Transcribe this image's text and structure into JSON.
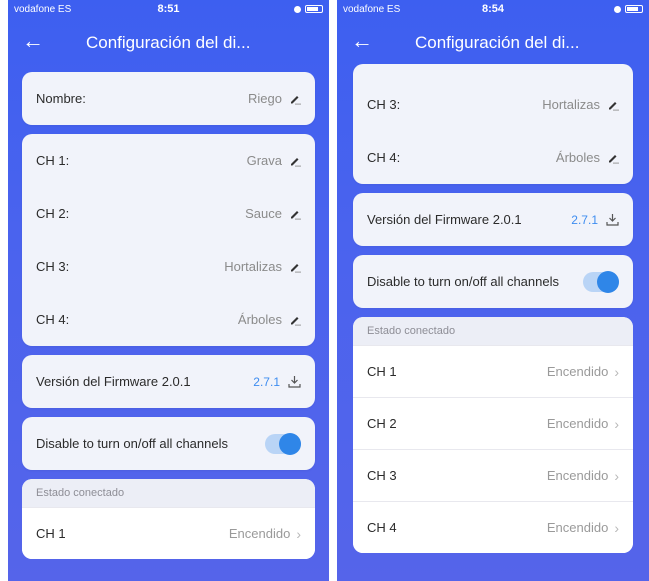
{
  "left": {
    "status": {
      "carrier": "vodafone ES",
      "time": "8:51"
    },
    "nav": {
      "title": "Configuración del di..."
    },
    "name_row": {
      "label": "Nombre:",
      "value": "Riego"
    },
    "channels": [
      {
        "label": "CH 1:",
        "value": "Grava"
      },
      {
        "label": "CH 2:",
        "value": "Sauce"
      },
      {
        "label": "CH 3:",
        "value": "Hortalizas"
      },
      {
        "label": "CH 4:",
        "value": "Árboles"
      }
    ],
    "firmware": {
      "label": "Versión del Firmware 2.0.1",
      "value": "2.7.1"
    },
    "toggle": {
      "label": "Disable to turn on/off all channels",
      "state": "on"
    },
    "estado": {
      "header": "Estado conectado",
      "rows": [
        {
          "label": "CH 1",
          "state": "Encendido"
        }
      ]
    }
  },
  "right": {
    "status": {
      "carrier": "vodafone ES",
      "time": "8:54"
    },
    "nav": {
      "title": "Configuración del di..."
    },
    "channels": [
      {
        "label": "CH 3:",
        "value": "Hortalizas"
      },
      {
        "label": "CH 4:",
        "value": "Árboles"
      }
    ],
    "firmware": {
      "label": "Versión del Firmware 2.0.1",
      "value": "2.7.1"
    },
    "toggle": {
      "label": "Disable to turn on/off all channels",
      "state": "on"
    },
    "estado": {
      "header": "Estado conectado",
      "rows": [
        {
          "label": "CH 1",
          "state": "Encendido"
        },
        {
          "label": "CH 2",
          "state": "Encendido"
        },
        {
          "label": "CH 3",
          "state": "Encendido"
        },
        {
          "label": "CH 4",
          "state": "Encendido"
        }
      ]
    }
  },
  "colors": {
    "header_blue": "#3d5ff0",
    "accent": "#2f86e8",
    "firmware_link": "#3d8cf0"
  }
}
